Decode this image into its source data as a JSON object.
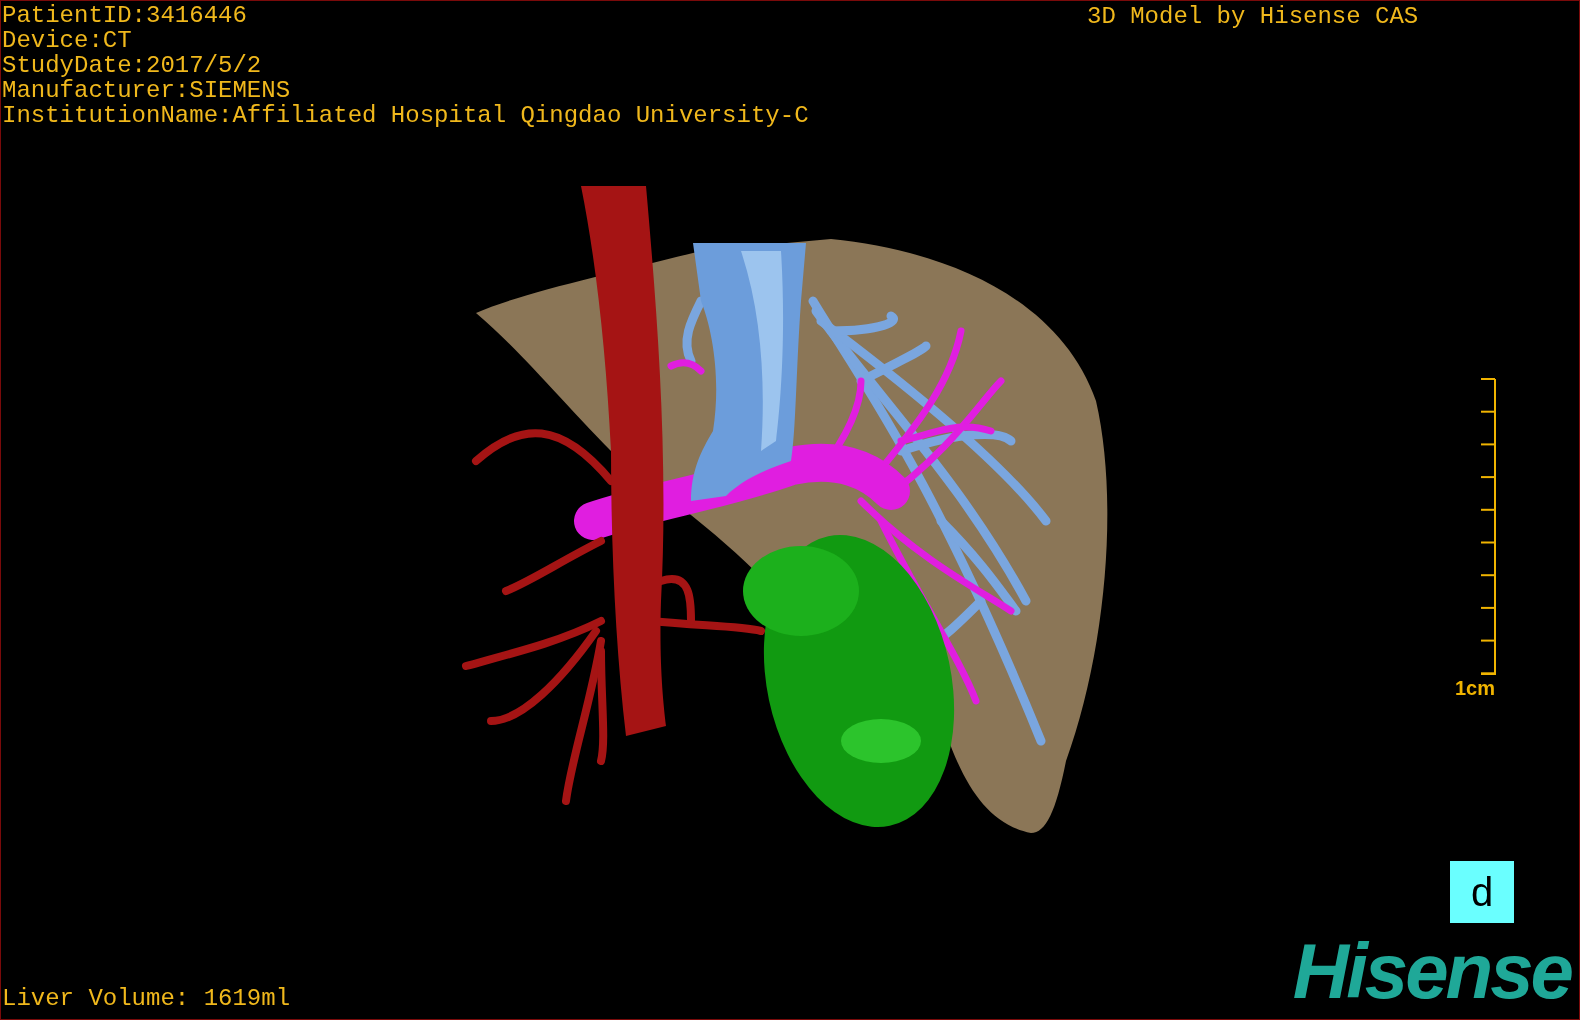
{
  "info_lines": [
    "PatientID:3416446",
    "Device:CT",
    "StudyDate:2017/5/2",
    "Manufacturer:SIEMENS",
    "InstitutionName:Affiliated Hospital Qingdao University-C"
  ],
  "credit": "3D Model by Hisense CAS",
  "scale": {
    "label": "1cm"
  },
  "orientation_marker": {
    "label": "d"
  },
  "liver_volume": "Liver Volume: 1619ml",
  "logo": "Hisense"
}
